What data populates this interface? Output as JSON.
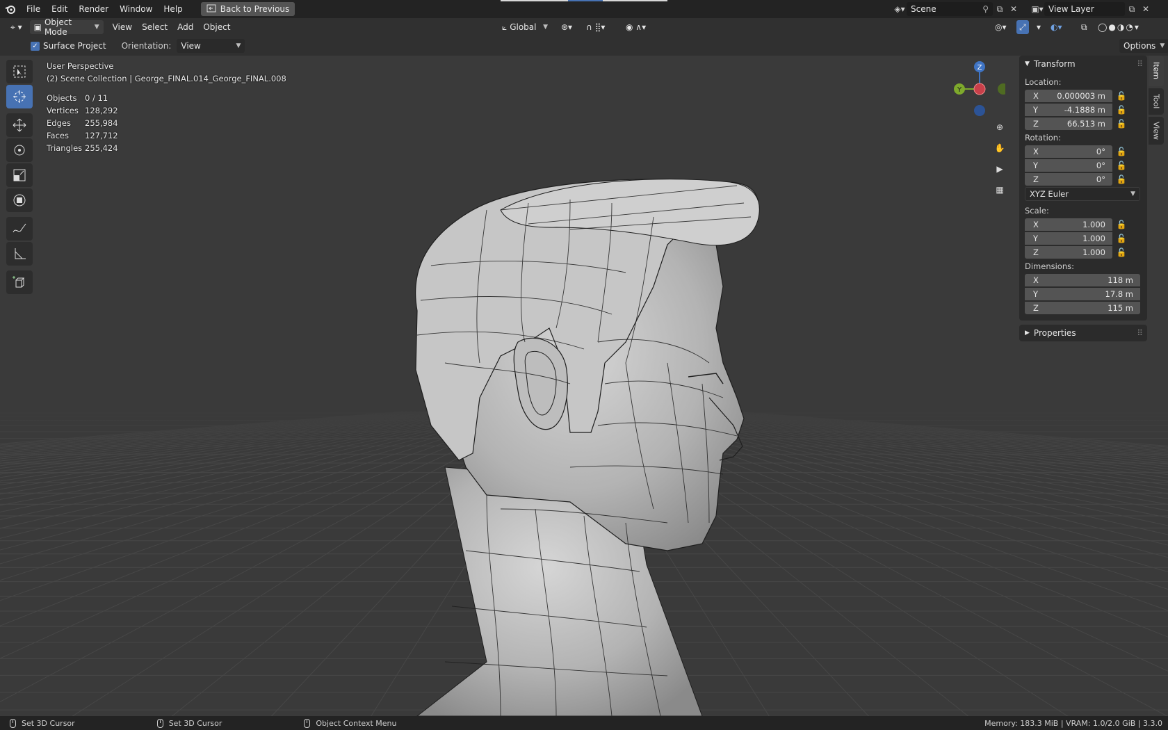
{
  "menubar": {
    "items": [
      "File",
      "Edit",
      "Render",
      "Window",
      "Help"
    ],
    "back_button": "Back to Previous",
    "scene_name": "Scene",
    "view_layer_name": "View Layer"
  },
  "header": {
    "mode": "Object Mode",
    "menus": [
      "View",
      "Select",
      "Add",
      "Object"
    ],
    "transform_orientation": "Global"
  },
  "tool_settings": {
    "surface_project_label": "Surface Project",
    "surface_project_checked": true,
    "orientation_label": "Orientation:",
    "orientation_value": "View",
    "options_label": "Options"
  },
  "overlay": {
    "perspective": "User Perspective",
    "collection": "(2) Scene Collection | George_FINAL.014_George_FINAL.008",
    "stats": [
      {
        "label": "Objects",
        "value": "0 / 11"
      },
      {
        "label": "Vertices",
        "value": "128,292"
      },
      {
        "label": "Edges",
        "value": "255,984"
      },
      {
        "label": "Faces",
        "value": "127,712"
      },
      {
        "label": "Triangles",
        "value": "255,424"
      }
    ]
  },
  "gizmo": {
    "x": "X",
    "y": "Y",
    "z": "Z"
  },
  "npanel": {
    "transform_title": "Transform",
    "location_label": "Location:",
    "location": [
      {
        "axis": "X",
        "value": "0.000003 m"
      },
      {
        "axis": "Y",
        "value": "-4.1888 m"
      },
      {
        "axis": "Z",
        "value": "66.513 m"
      }
    ],
    "rotation_label": "Rotation:",
    "rotation": [
      {
        "axis": "X",
        "value": "0°"
      },
      {
        "axis": "Y",
        "value": "0°"
      },
      {
        "axis": "Z",
        "value": "0°"
      }
    ],
    "rotation_mode": "XYZ Euler",
    "scale_label": "Scale:",
    "scale": [
      {
        "axis": "X",
        "value": "1.000"
      },
      {
        "axis": "Y",
        "value": "1.000"
      },
      {
        "axis": "Z",
        "value": "1.000"
      }
    ],
    "dimensions_label": "Dimensions:",
    "dimensions": [
      {
        "axis": "X",
        "value": "118 m"
      },
      {
        "axis": "Y",
        "value": "17.8 m"
      },
      {
        "axis": "Z",
        "value": "115 m"
      }
    ],
    "properties_title": "Properties",
    "tabs": [
      "Item",
      "Tool",
      "View"
    ]
  },
  "statusbar": {
    "left_click": "Set 3D Cursor",
    "middle_click": "Set 3D Cursor",
    "right_click": "Object Context Menu",
    "info": "Memory: 183.3 MiB | VRAM: 1.0/2.0 GiB | 3.3.0"
  },
  "colors": {
    "accent": "#4772b3",
    "axis_x": "#c9404a",
    "axis_y": "#7ea92c",
    "axis_z": "#3f74c4"
  }
}
